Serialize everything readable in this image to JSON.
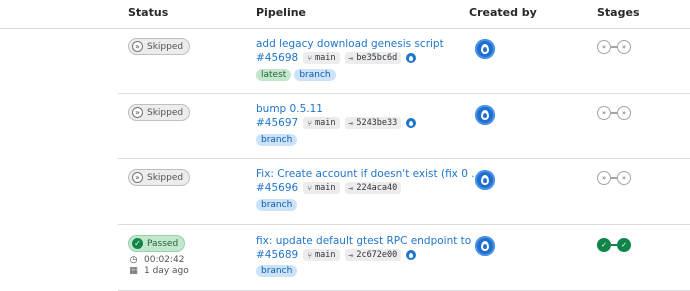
{
  "columns": {
    "status": "Status",
    "pipeline": "Pipeline",
    "created_by": "Created by",
    "stages": "Stages"
  },
  "icons": {
    "skipped": "skipped-icon",
    "passed": "check-circle-icon",
    "branch": "branch-icon",
    "commit": "commit-icon",
    "timer": "timer-icon",
    "calendar": "calendar-icon",
    "avatar": "user-avatar"
  },
  "colors": {
    "link": "#1f75cb",
    "passed": "#108548",
    "skipped": "#737278",
    "latest_tag_bg": "#c3e6cd",
    "branch_tag_bg": "#cbe2f9"
  },
  "rows": [
    {
      "status": "Skipped",
      "title": "add legacy download genesis script",
      "id": "#45698",
      "branch": "main",
      "commit": "be35bc6d",
      "tags": [
        "latest",
        "branch"
      ],
      "stages": [
        "skipped",
        "skipped"
      ]
    },
    {
      "status": "Skipped",
      "title": "bump 0.5.11",
      "id": "#45697",
      "branch": "main",
      "commit": "5243be33",
      "tags": [
        "branch"
      ],
      "stages": [
        "skipped",
        "skipped"
      ]
    },
    {
      "status": "Skipped",
      "title": "Fix: Create account if doesn't exist (fix 0 ...",
      "id": "#45696",
      "branch": "main",
      "commit": "224aca40",
      "tags": [
        "branch"
      ],
      "stages": [
        "skipped",
        "skipped"
      ]
    },
    {
      "status": "Passed",
      "duration": "00:02:42",
      "finished": "1 day ago",
      "title": "fix: update default gtest RPC endpoint to ...",
      "id": "#45689",
      "branch": "main",
      "commit": "2c672e00",
      "tags": [
        "branch"
      ],
      "stages": [
        "passed",
        "passed"
      ]
    }
  ]
}
